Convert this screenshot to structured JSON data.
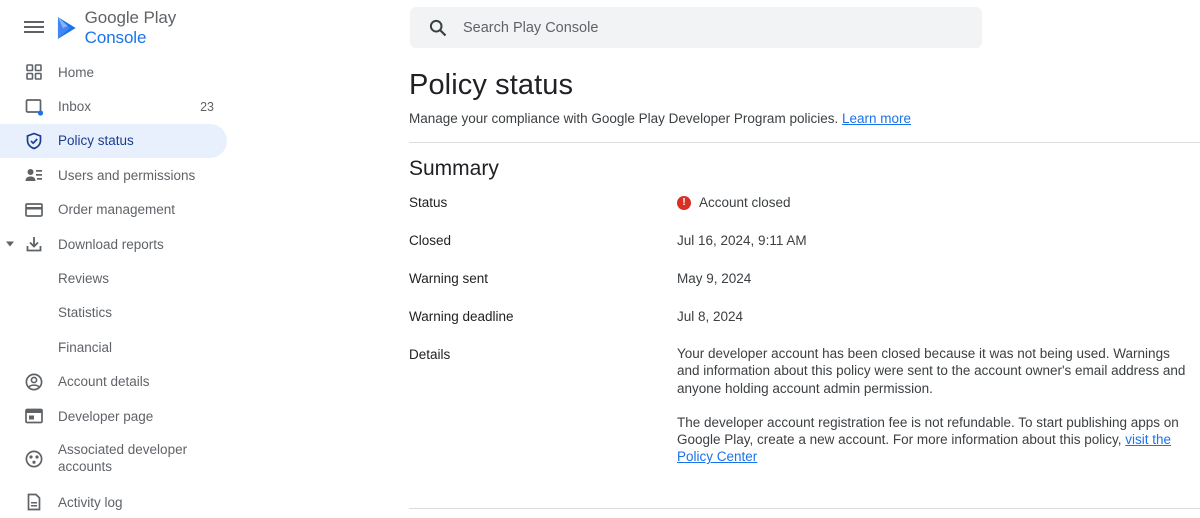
{
  "app": {
    "logo_text_main": "Google Play",
    "logo_text_accent": "Console"
  },
  "search": {
    "placeholder": "Search Play Console"
  },
  "sidebar": {
    "items": [
      {
        "label": "Home",
        "icon": "home-grid-icon"
      },
      {
        "label": "Inbox",
        "icon": "inbox-icon",
        "badge": "23"
      },
      {
        "label": "Policy status",
        "icon": "shield-icon",
        "active": true
      },
      {
        "label": "Users and permissions",
        "icon": "users-icon"
      },
      {
        "label": "Order management",
        "icon": "credit-card-icon"
      },
      {
        "label": "Download reports",
        "icon": "download-icon",
        "expanded": true
      },
      {
        "label": "Reviews"
      },
      {
        "label": "Statistics"
      },
      {
        "label": "Financial"
      },
      {
        "label": "Account details",
        "icon": "account-circle-icon"
      },
      {
        "label": "Developer page",
        "icon": "web-page-icon"
      },
      {
        "label": "Associated developer accounts",
        "icon": "associated-accounts-icon"
      },
      {
        "label": "Activity log",
        "icon": "document-icon"
      }
    ]
  },
  "main": {
    "title": "Policy status",
    "subtitle": "Manage your compliance with Google Play Developer Program policies.",
    "learn_more": "Learn more",
    "summary_title": "Summary",
    "rows": {
      "status_label": "Status",
      "status_value": "Account closed",
      "closed_label": "Closed",
      "closed_value": "Jul 16, 2024, 9:11 AM",
      "warning_sent_label": "Warning sent",
      "warning_sent_value": "May 9, 2024",
      "warning_deadline_label": "Warning deadline",
      "warning_deadline_value": "Jul 8, 2024",
      "details_label": "Details",
      "details_paragraph_1": "Your developer account has been closed because it was not being used. Warnings and information about this policy were sent to the account owner's email address and anyone holding account admin permission.",
      "details_paragraph_2": "The developer account registration fee is not refundable. To start publishing apps on Google Play, create a new account. For more information about this policy,",
      "details_link": "visit the Policy Center"
    }
  },
  "colors": {
    "accent": "#1a73e8",
    "active_bg": "#e8f0fe",
    "error": "#d93025"
  }
}
